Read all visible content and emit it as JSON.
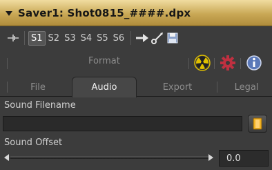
{
  "title": "Saver1: Shot0815_####.dpx",
  "toolbar": {
    "slots": [
      "S1",
      "S2",
      "S3",
      "S4",
      "S5",
      "S6"
    ],
    "active_slot": "S1"
  },
  "subrow": {
    "format_label": "Format"
  },
  "tabs": [
    {
      "label": "File",
      "active": false
    },
    {
      "label": "Audio",
      "active": true
    },
    {
      "label": "Export",
      "active": false
    },
    {
      "label": "Legal",
      "active": false
    }
  ],
  "sound_filename": {
    "label": "Sound Filename",
    "value": ""
  },
  "sound_offset": {
    "label": "Sound Offset",
    "value": "0.0"
  },
  "colors": {
    "title_bar": "#c9a855",
    "panel_bg": "#3c3c3c",
    "radiation_icon": "#e0c000",
    "gear_icon": "#c03040",
    "info_icon": "#5a78b8"
  }
}
